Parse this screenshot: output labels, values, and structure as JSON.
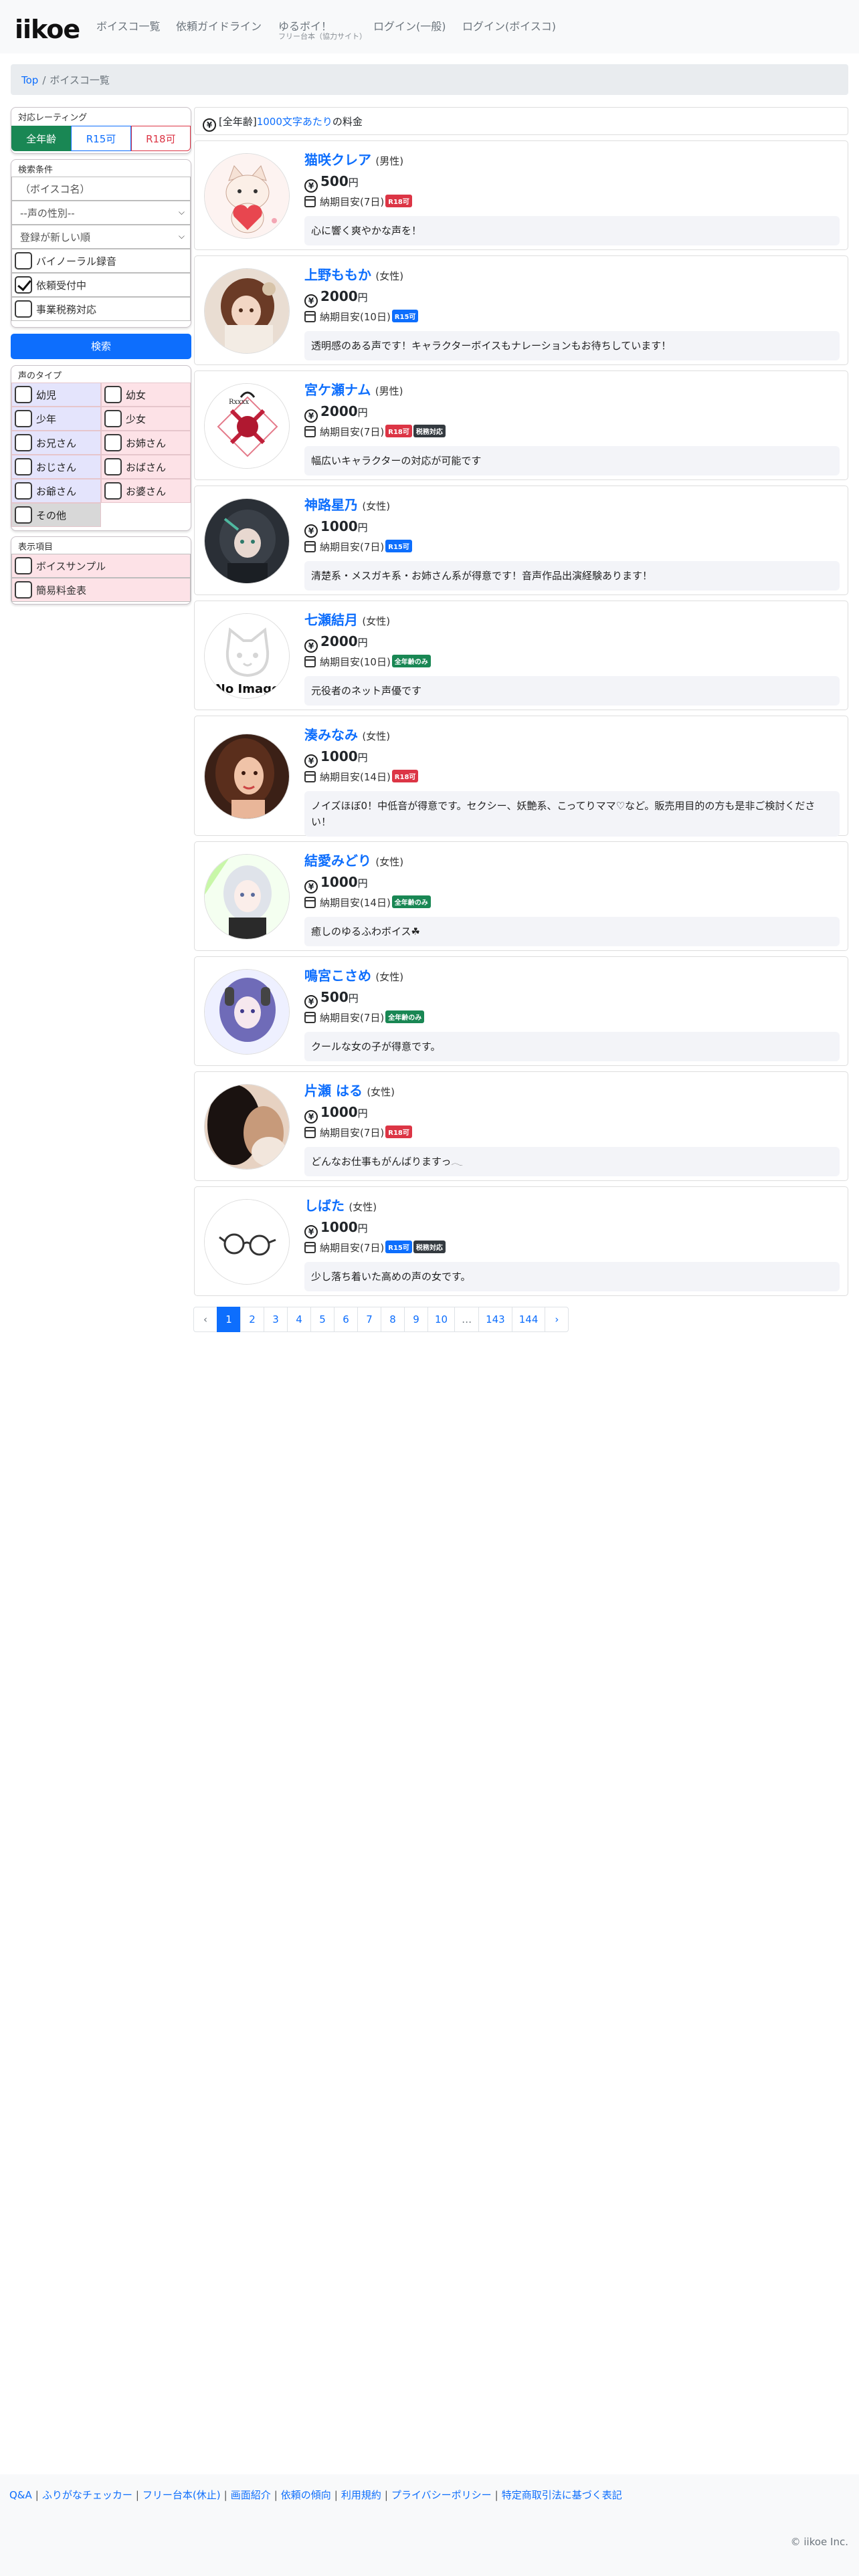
{
  "header": {
    "brand": "iikoe",
    "nav": [
      {
        "label": "ボイスコ一覧"
      },
      {
        "label": "依頼ガイドライン"
      },
      {
        "label": "ゆるボイ！",
        "sub": "フリー台本（協力サイト）"
      },
      {
        "label": "ログイン(一般)"
      },
      {
        "label": "ログイン(ボイスコ)"
      }
    ]
  },
  "breadcrumb": {
    "home": "Top",
    "sep": "/",
    "current": "ボイスコ一覧"
  },
  "sidebar": {
    "rating": {
      "title": "対応レーティング",
      "options": [
        "全年齢",
        "R15可",
        "R18可"
      ],
      "selected": "全年齢"
    },
    "search": {
      "title": "検索条件",
      "name_placeholder": "（ボイスコ名）",
      "gender_select": "--声の性別--",
      "sort_select": "登録が新しい順",
      "checks": [
        {
          "label": "バイノーラル録音",
          "checked": false
        },
        {
          "label": "依頼受付中",
          "checked": true
        },
        {
          "label": "事業税務対応",
          "checked": false
        }
      ],
      "button": "検索"
    },
    "voice_types": {
      "title": "声のタイプ",
      "items": [
        {
          "label": "幼児",
          "tone": "blue"
        },
        {
          "label": "幼女",
          "tone": "pink"
        },
        {
          "label": "少年",
          "tone": "blue"
        },
        {
          "label": "少女",
          "tone": "pink"
        },
        {
          "label": "お兄さん",
          "tone": "blue"
        },
        {
          "label": "お姉さん",
          "tone": "pink"
        },
        {
          "label": "おじさん",
          "tone": "blue"
        },
        {
          "label": "おばさん",
          "tone": "pink"
        },
        {
          "label": "お爺さん",
          "tone": "blue"
        },
        {
          "label": "お婆さん",
          "tone": "pink"
        },
        {
          "label": "その他",
          "tone": "gray"
        }
      ]
    },
    "display": {
      "title": "表示項目",
      "items": [
        {
          "label": "ボイスサンプル"
        },
        {
          "label": "簡易料金表"
        }
      ]
    }
  },
  "list_header": {
    "prefix": "[全年齢]",
    "link": "1000文字あたり",
    "suffix": "の料金",
    "icon": "yen-circle-icon"
  },
  "voices": [
    {
      "name": "猫咲クレア",
      "gender": "(男性)",
      "price": "500",
      "unit": "円",
      "delivery": "納期目安(7日)",
      "badges": [
        {
          "text": "R18可",
          "color": "red"
        }
      ],
      "message": "心に響く爽やかな声を！",
      "avatar": "cat-heart"
    },
    {
      "name": "上野ももか",
      "gender": "(女性)",
      "price": "2000",
      "unit": "円",
      "delivery": "納期目安(10日)",
      "badges": [
        {
          "text": "R15可",
          "color": "blue"
        }
      ],
      "message": "透明感のある声です！キャラクターボイスもナレーションもお待ちしています！",
      "avatar": "brown-girl"
    },
    {
      "name": "宮ケ瀬ナム",
      "gender": "(男性)",
      "price": "2000",
      "unit": "円",
      "delivery": "納期目安(7日)",
      "badges": [
        {
          "text": "R18可",
          "color": "red"
        },
        {
          "text": "税務対応",
          "color": "dark"
        }
      ],
      "message": "幅広いキャラクターの対応が可能です",
      "avatar": "crimson-logo"
    },
    {
      "name": "神路星乃",
      "gender": "(女性)",
      "price": "1000",
      "unit": "円",
      "delivery": "納期目安(7日)",
      "badges": [
        {
          "text": "R15可",
          "color": "blue"
        }
      ],
      "message": "清楚系・メスガキ系・お姉さん系が得意です！音声作品出演経験あります！",
      "avatar": "dark-girl"
    },
    {
      "name": "七瀬結月",
      "gender": "(女性)",
      "price": "2000",
      "unit": "円",
      "delivery": "納期目安(10日)",
      "badges": [
        {
          "text": "全年齢のみ",
          "color": "green"
        }
      ],
      "message": "元役者のネット声優です",
      "avatar": "no-image-cat",
      "avatar_text": "No Image"
    },
    {
      "name": "湊みなみ",
      "gender": "(女性)",
      "price": "1000",
      "unit": "円",
      "delivery": "納期目安(14日)",
      "badges": [
        {
          "text": "R18可",
          "color": "red"
        }
      ],
      "message": "ノイズほぼ0！中低音が得意です。セクシー、妖艶系、こってりママ♡など。販売用目的の方も是非ご検討ください！",
      "avatar": "brunette-woman"
    },
    {
      "name": "結愛みどり",
      "gender": "(女性)",
      "price": "1000",
      "unit": "円",
      "delivery": "納期目安(14日)",
      "badges": [
        {
          "text": "全年齢のみ",
          "color": "green"
        }
      ],
      "message": "癒しのゆるふわボイス☘",
      "avatar": "silver-girl"
    },
    {
      "name": "鳴宮こさめ",
      "gender": "(女性)",
      "price": "500",
      "unit": "円",
      "delivery": "納期目安(7日)",
      "badges": [
        {
          "text": "全年齢のみ",
          "color": "green"
        }
      ],
      "message": "クールな女の子が得意です。",
      "avatar": "purple-girl"
    },
    {
      "name": "片瀬 はる",
      "gender": "(女性)",
      "price": "1000",
      "unit": "円",
      "delivery": "納期目安(7日)",
      "badges": [
        {
          "text": "R18可",
          "color": "red"
        }
      ],
      "message": "どんなお仕事もがんばりますっ𓂃",
      "avatar": "photo-dark"
    },
    {
      "name": "しばた",
      "gender": "(女性)",
      "price": "1000",
      "unit": "円",
      "delivery": "納期目安(7日)",
      "badges": [
        {
          "text": "R15可",
          "color": "blue"
        },
        {
          "text": "税務対応",
          "color": "dark"
        }
      ],
      "message": "少し落ち着いた高めの声の女です。",
      "avatar": "glasses-sketch"
    }
  ],
  "pagination": [
    "‹",
    "1",
    "2",
    "3",
    "4",
    "5",
    "6",
    "7",
    "8",
    "9",
    "10",
    "…",
    "143",
    "144",
    "›"
  ],
  "pagination_active": "1",
  "footer": {
    "links": [
      "Q&A",
      "ふりがなチェッカー",
      "フリー台本(休止)",
      "画面紹介",
      "依頼の傾向",
      "利用規約",
      "プライバシーポリシー",
      "特定商取引法に基づく表記"
    ],
    "copyright": "© iikoe Inc."
  }
}
